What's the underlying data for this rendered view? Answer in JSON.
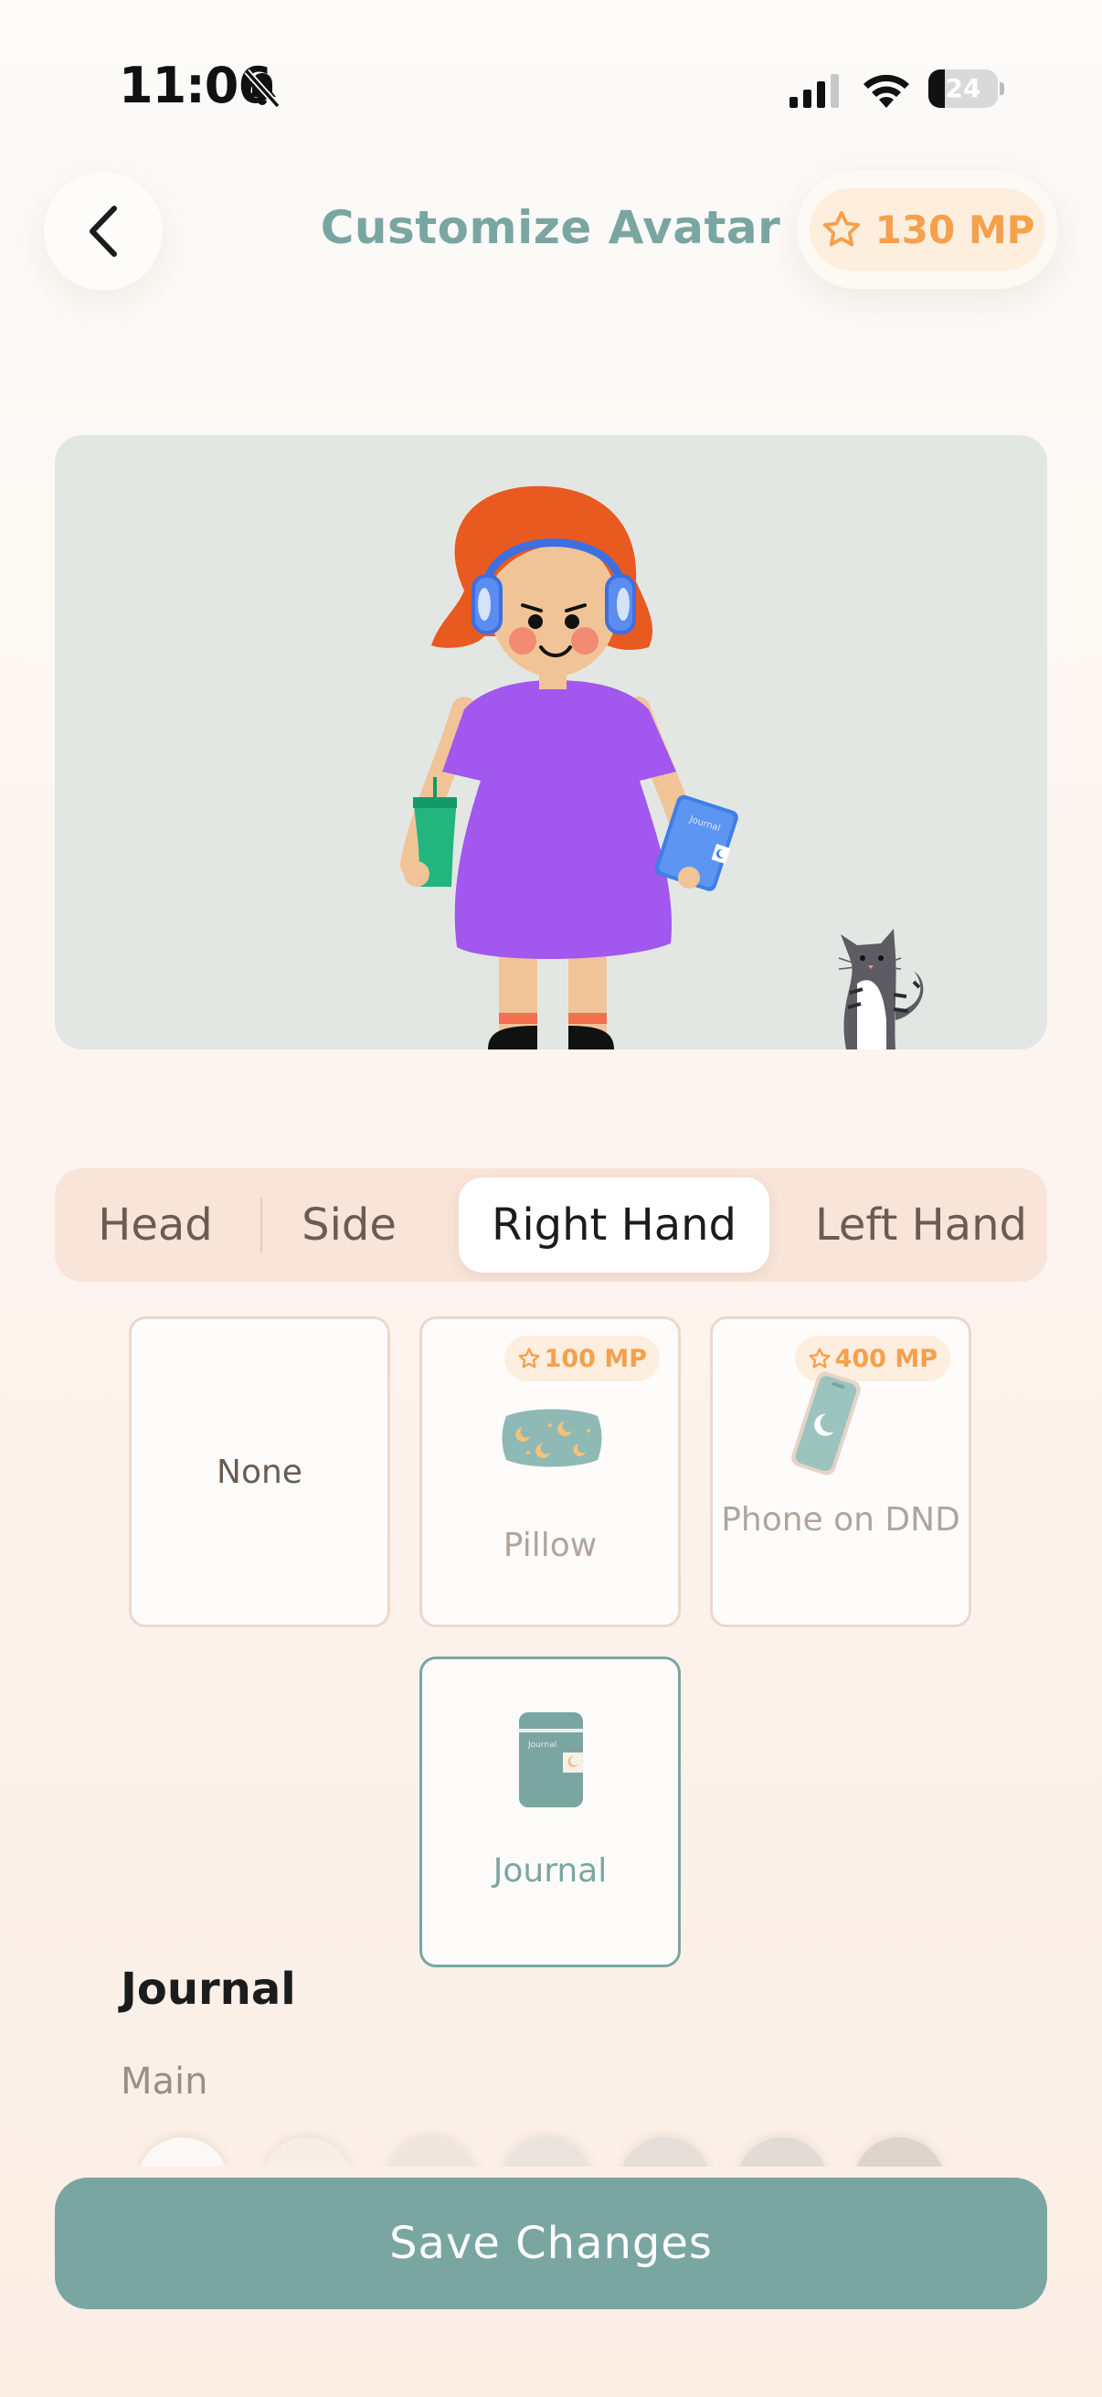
{
  "status_bar": {
    "time": "11:06",
    "battery": "24",
    "battery_level": 0.24,
    "icons": [
      "bell-slash-icon",
      "cellular-signal-icon",
      "wifi-icon",
      "battery-icon"
    ]
  },
  "header": {
    "title": "Customize Avatar",
    "points": "130 MP",
    "back_icon": "chevron-left-icon",
    "points_icon": "star-outline-icon"
  },
  "tabs": [
    {
      "label": "Head",
      "active": false
    },
    {
      "label": "Side",
      "active": false
    },
    {
      "label": "Right Hand",
      "active": true
    },
    {
      "label": "Left Hand",
      "active": false
    }
  ],
  "items": [
    {
      "label": "None",
      "price": "",
      "selected": false
    },
    {
      "label": "Pillow",
      "price": "100 MP",
      "selected": false
    },
    {
      "label": "Phone on DND",
      "price": "400 MP",
      "selected": false
    },
    {
      "label": "Journal",
      "price": "",
      "selected": true
    }
  ],
  "detail": {
    "title": "Journal",
    "subtitle": "Main"
  },
  "save_label": "Save Changes",
  "colors": {
    "accent": "#7aa6a2",
    "points": "#f6a04b",
    "tab_bg": "#f8e4d8"
  }
}
